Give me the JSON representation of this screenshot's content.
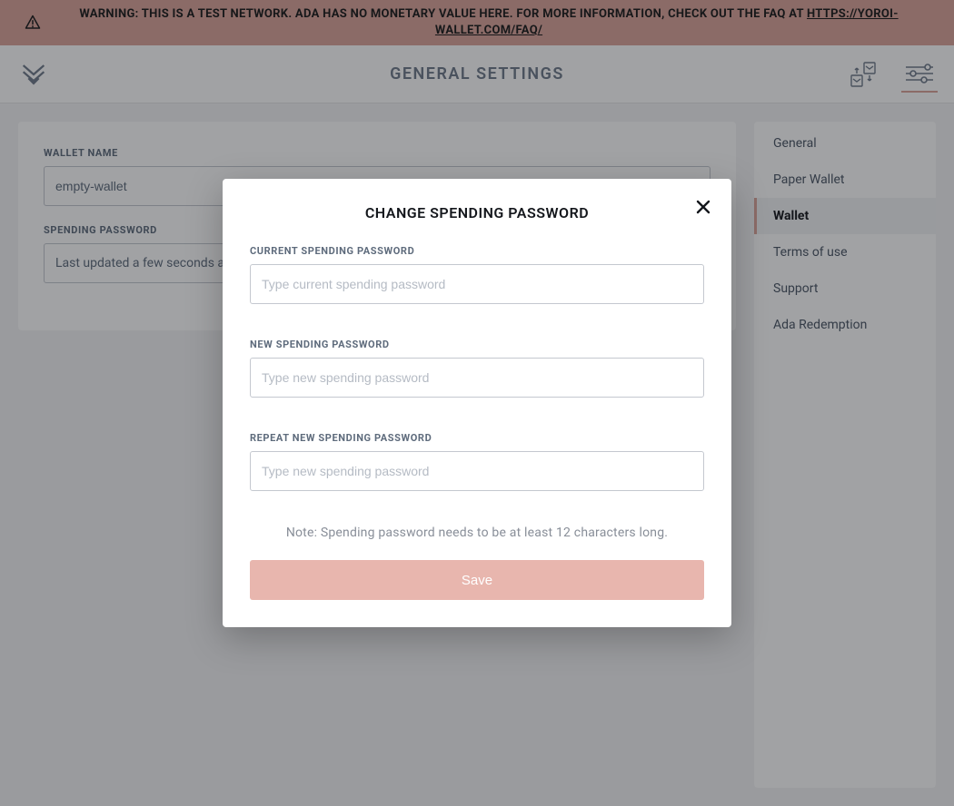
{
  "banner": {
    "text_prefix": "WARNING: THIS IS A TEST NETWORK. ADA HAS NO MONETARY VALUE HERE. FOR MORE INFORMATION, CHECK OUT THE FAQ AT ",
    "link_text": "HTTPS://YOROI-WALLET.COM/FAQ/"
  },
  "header": {
    "title": "GENERAL SETTINGS"
  },
  "main": {
    "wallet_name": {
      "label": "WALLET NAME",
      "value": "empty-wallet"
    },
    "spending_password": {
      "label": "SPENDING PASSWORD",
      "status": "Last updated a few seconds ago"
    }
  },
  "sidebar": {
    "items": [
      {
        "label": "General",
        "active": false
      },
      {
        "label": "Paper Wallet",
        "active": false
      },
      {
        "label": "Wallet",
        "active": true
      },
      {
        "label": "Terms of use",
        "active": false
      },
      {
        "label": "Support",
        "active": false
      },
      {
        "label": "Ada Redemption",
        "active": false
      }
    ]
  },
  "modal": {
    "title": "CHANGE SPENDING PASSWORD",
    "current": {
      "label": "CURRENT SPENDING PASSWORD",
      "placeholder": "Type current spending password"
    },
    "new": {
      "label": "NEW SPENDING PASSWORD",
      "placeholder": "Type new spending password"
    },
    "repeat": {
      "label": "REPEAT NEW SPENDING PASSWORD",
      "placeholder": "Type new spending password"
    },
    "note": "Note: Spending password needs to be at least 12 characters long.",
    "save_label": "Save"
  },
  "colors": {
    "accent": "#DAA49A"
  }
}
